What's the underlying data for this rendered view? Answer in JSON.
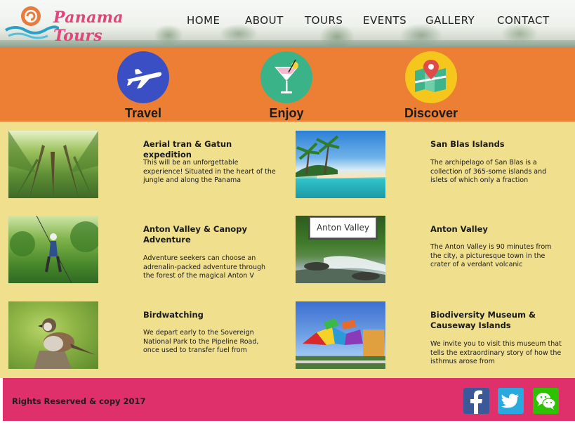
{
  "brand": {
    "name": "Panama Tours"
  },
  "nav": {
    "items": [
      "HOME",
      "ABOUT",
      "TOURS",
      "EVENTS",
      "GALLERY",
      "CONTACT"
    ]
  },
  "features": [
    {
      "label": "Travel",
      "icon": "airplane-icon",
      "color": "#3b4fc4"
    },
    {
      "label": "Enjoy",
      "icon": "cocktail-icon",
      "color": "#3bb389"
    },
    {
      "label": "Discover",
      "icon": "map-icon",
      "color": "#f5c61b"
    }
  ],
  "tours": [
    {
      "title": "Aerial tran & Gatun expedition",
      "desc": "This will be an unforgettable experience! Situated in the heart of the jungle and along the Panama",
      "image": "jungle-canopy-image"
    },
    {
      "title": "San Blas Islands",
      "desc": "The archipelago of San Blas is a collection of 365-some islands and islets of which only a fraction",
      "image": "beach-island-image"
    },
    {
      "title": "Anton Valley & Canopy Adventure",
      "desc": "Adventure seekers can choose an adrenalin-packed adventure through the forest of the magical Anton V",
      "image": "zipline-image"
    },
    {
      "title": "Anton Valley",
      "desc": "The Anton Valley is 90 minutes from the city, a picturesque town in the crater of a verdant volcanic",
      "image": "waterfall-image"
    },
    {
      "title": "Birdwatching",
      "desc": "We depart early to the Sovereign National Park to the Pipeline Road, once used to transfer fuel from",
      "image": "sparrow-image"
    },
    {
      "title": "Biodiversity Museum & Causeway Islands",
      "desc": "We invite you to visit this museum that tells the extraordinary story of how the isthmus arose from",
      "image": "museum-image"
    }
  ],
  "tooltip": {
    "text": "Anton Valley"
  },
  "footer": {
    "copyright": "Rights Reserved & copy 2017",
    "social": [
      {
        "name": "facebook",
        "color": "#3b5998"
      },
      {
        "name": "twitter",
        "color": "#2aa9e0"
      },
      {
        "name": "wechat",
        "color": "#2dc100"
      }
    ]
  },
  "colors": {
    "band": "#ec7f34",
    "content_bg": "#f0e08e",
    "footer": "#e0306b",
    "brand_pink": "#e0457b"
  }
}
